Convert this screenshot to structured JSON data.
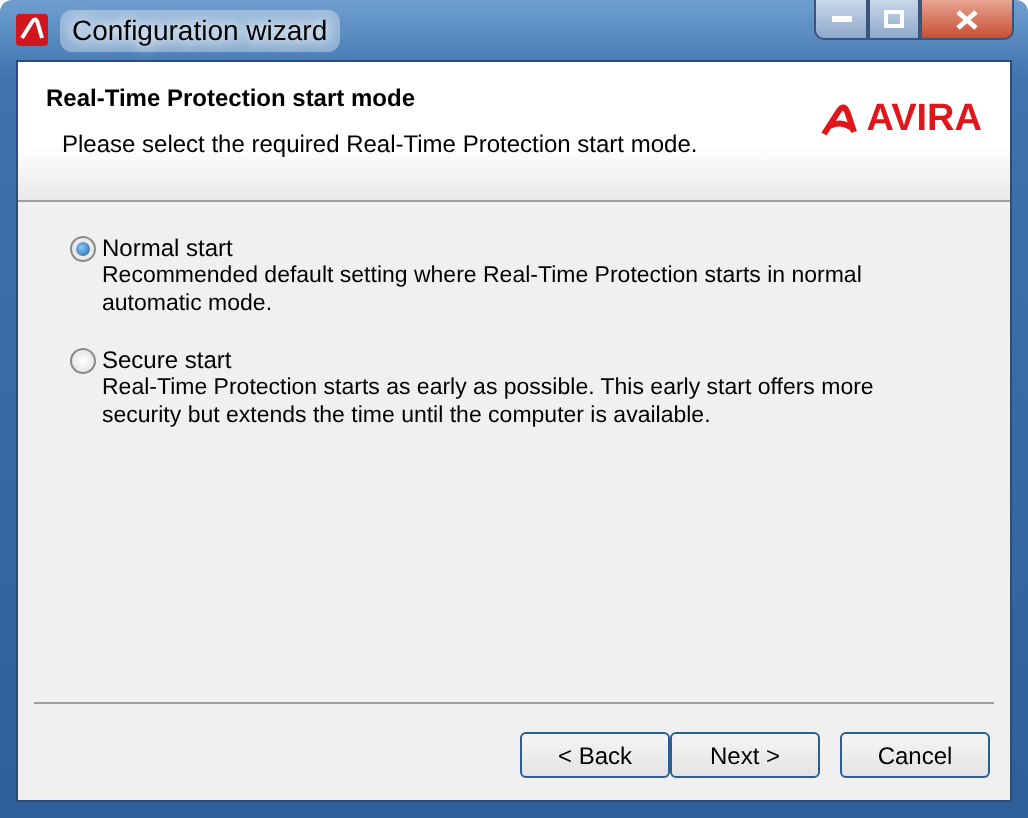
{
  "window": {
    "title": "Configuration wizard"
  },
  "header": {
    "title": "Real-Time Protection start mode",
    "subtitle": "Please select the required Real-Time Protection start mode.",
    "logo_text": "AVIRA"
  },
  "options": [
    {
      "label": "Normal start",
      "description": "Recommended default setting where Real-Time Protection starts in normal automatic mode.",
      "selected": true
    },
    {
      "label": "Secure start",
      "description": "Real-Time Protection starts as early as possible. This early start offers more security but extends the time until the computer is available.",
      "selected": false
    }
  ],
  "buttons": [
    "< Back",
    "Next >",
    "Cancel"
  ]
}
